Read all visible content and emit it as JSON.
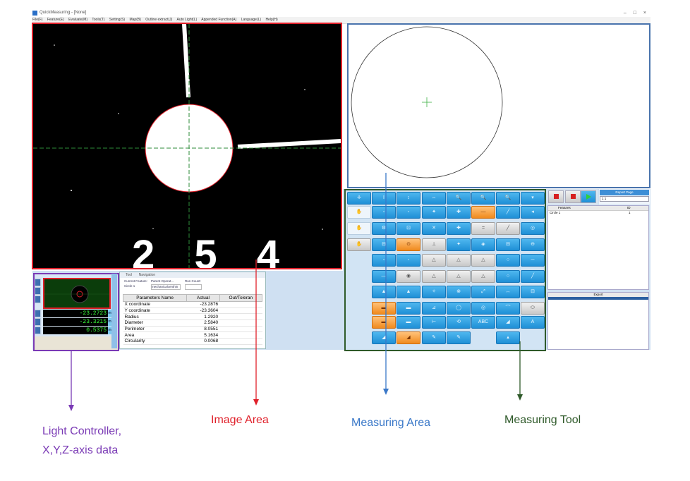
{
  "window": {
    "title": "QuickMeasuring - [None]",
    "menus": [
      "File(F)",
      "Feature(E)",
      "Evaluate(M)",
      "Tools(T)",
      "Setting(S)",
      "Map(B)",
      "Outline extract(J)",
      "Auto Light(L)",
      "Appended Function(A)",
      "Language(L)",
      "Help(H)"
    ],
    "controls": "–  □  ×"
  },
  "image_area": {
    "overlay_text": "2 5 4",
    "circle_color": "#ffffff",
    "crosshair_color": "#2e8b3a"
  },
  "light_controller": {
    "coords": [
      {
        "value": "-23.2723",
        "unit": "mm"
      },
      {
        "value": "-23.3215",
        "unit": "mm"
      },
      {
        "value": "0.5375",
        "unit": "mm"
      }
    ]
  },
  "feature_panel": {
    "tabs": [
      "Tool",
      "Navigation"
    ],
    "current_feature_label": "Current Feature:",
    "current_feature": "Circle 1",
    "parent_operation_label": "Parent Operat...",
    "parent_operation": "mechanicalcenthin",
    "run_count_label": "Run Count:",
    "table": {
      "headers": [
        "Parameters Name",
        "Actual",
        "Out/Toleran"
      ],
      "rows": [
        {
          "name": "X coordinate",
          "actual": "-23.2876",
          "tol": ""
        },
        {
          "name": "Y coordinate",
          "actual": "-23.3604",
          "tol": ""
        },
        {
          "name": "Radius",
          "actual": "1.2920",
          "tol": ""
        },
        {
          "name": "Diameter",
          "actual": "2.5840",
          "tol": ""
        },
        {
          "name": "Perimeter",
          "actual": "8.0551",
          "tol": ""
        },
        {
          "name": "Area",
          "actual": "5.1634",
          "tol": ""
        },
        {
          "name": "Circularity",
          "actual": "0.0068",
          "tol": ""
        }
      ]
    }
  },
  "tool_panel": {
    "buttons": [
      [
        "✛",
        "I",
        "↕",
        "⇔",
        "🔍",
        "🔍",
        "🔍",
        "▾"
      ],
      [
        "✋",
        "◦",
        "◦",
        "✦",
        "✚",
        "—",
        "╱",
        "◂"
      ],
      [
        "✋",
        "⚙",
        "⊡",
        "✕",
        "✚",
        "=",
        "╱",
        "◎"
      ],
      [
        "✋",
        "⊟",
        "⊙",
        "⊥",
        "✦",
        "◈",
        "⊟",
        "⊖"
      ],
      [
        "",
        "◦",
        "◦",
        "△",
        "△",
        "△",
        "○",
        "─"
      ],
      [
        "",
        "—",
        "◉",
        "△",
        "△",
        "△",
        "○",
        "╱"
      ],
      [
        "",
        "▲",
        "▲",
        "✧",
        "⊗",
        "⤢",
        "↔",
        "⊟"
      ],
      [
        "",
        "▬",
        "▬",
        "⊿",
        "◯",
        "◎",
        "⌒",
        "⬭"
      ],
      [
        "",
        "▬",
        "▬",
        "⊢",
        "⟲",
        "ABC",
        "◢",
        "A"
      ],
      [
        "",
        "◢",
        "◢",
        "✎",
        "✎",
        "",
        "▴",
        ""
      ]
    ]
  },
  "report": {
    "title": "Report Page",
    "value": "1  1"
  },
  "features_list": {
    "headers": [
      "Features",
      "ID"
    ],
    "rows": [
      {
        "name": "Circle 1",
        "id": "1"
      }
    ]
  },
  "export": {
    "title": "Export"
  },
  "annotations": {
    "light_controller": [
      "Light Controller,",
      "X,Y,Z-axis data"
    ],
    "image_area": "Image Area",
    "measuring_area": "Measuring Area",
    "measuring_tool": "Measuring Tool",
    "colors": {
      "purple": "#7a3ab5",
      "red": "#e0202a",
      "blue": "#3a78c8",
      "green": "#2f5a2a"
    }
  }
}
